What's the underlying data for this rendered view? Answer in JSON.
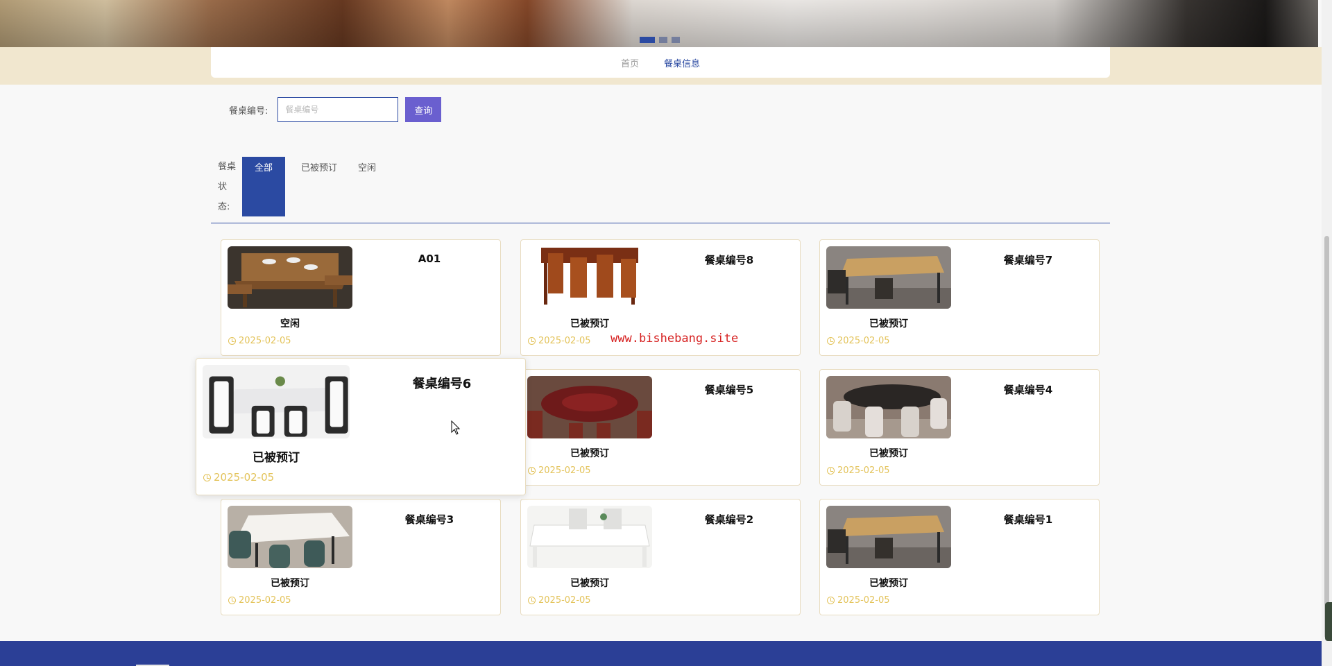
{
  "nav": {
    "items": [
      {
        "label": "首页"
      },
      {
        "label": "餐桌信息"
      }
    ]
  },
  "search": {
    "label": "餐桌编号:",
    "placeholder": "餐桌编号",
    "button_label": "查询"
  },
  "filter": {
    "label": "餐桌状态:",
    "tabs": [
      {
        "label": "全部"
      },
      {
        "label": "已被预订"
      },
      {
        "label": "空闲"
      }
    ]
  },
  "tables": [
    {
      "name": "A01",
      "status": "空闲",
      "date": "2025-02-05"
    },
    {
      "name": "餐桌编号8",
      "status": "已被预订",
      "date": "2025-02-05"
    },
    {
      "name": "餐桌编号7",
      "status": "已被预订",
      "date": "2025-02-05"
    },
    {
      "name": "餐桌编号6",
      "status": "已被预订",
      "date": "2025-02-05"
    },
    {
      "name": "餐桌编号5",
      "status": "已被预订",
      "date": "2025-02-05"
    },
    {
      "name": "餐桌编号4",
      "status": "已被预订",
      "date": "2025-02-05"
    },
    {
      "name": "餐桌编号3",
      "status": "已被预订",
      "date": "2025-02-05"
    },
    {
      "name": "餐桌编号2",
      "status": "已被预订",
      "date": "2025-02-05"
    },
    {
      "name": "餐桌编号1",
      "status": "已被预订",
      "date": "2025-02-05"
    }
  ],
  "watermark": "www.bishebang.site",
  "colors": {
    "primary": "#2b4aa2",
    "search_button": "#6a5fcf",
    "date": "#e3c35a",
    "nav_band": "#f1e7cf",
    "footer": "#2b3f96",
    "watermark": "#d62020"
  }
}
